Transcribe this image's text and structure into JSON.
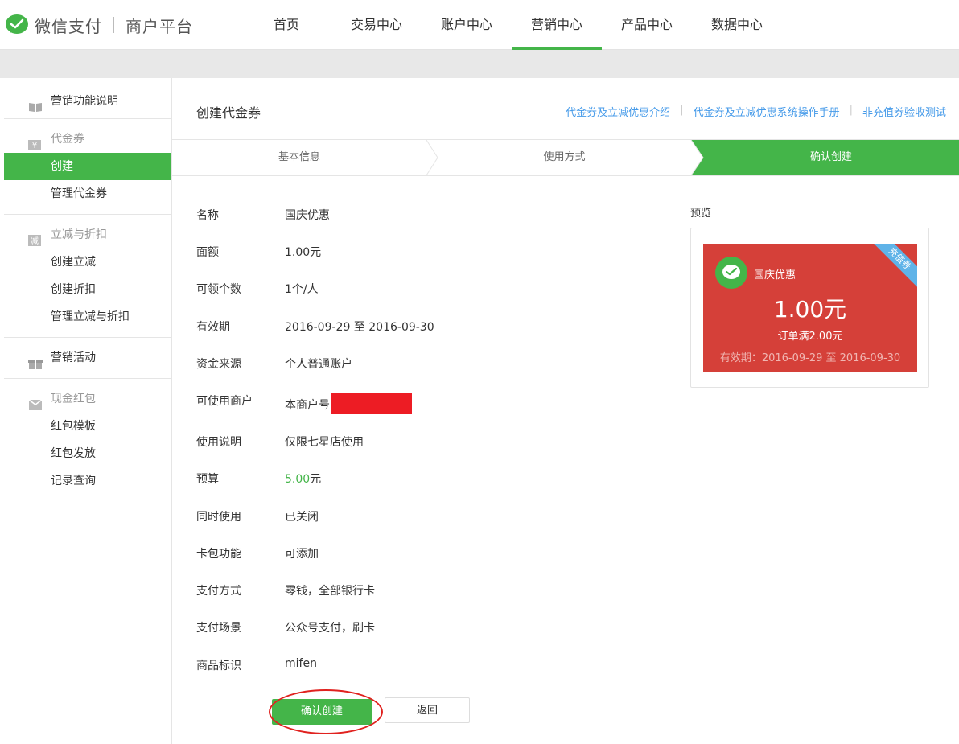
{
  "header": {
    "logo_text": "微信支付",
    "logo_sub": "商户平台",
    "nav": [
      "首页",
      "交易中心",
      "账户中心",
      "营销中心",
      "产品中心",
      "数据中心"
    ],
    "active_nav": "营销中心"
  },
  "sidebar": {
    "sections": [
      {
        "icon": "book-icon",
        "title": "营销功能说明",
        "items": []
      },
      {
        "icon": "yen-icon",
        "title": "代金券",
        "items": [
          "创建",
          "管理代金券"
        ],
        "active": "创建"
      },
      {
        "icon": "discount-icon",
        "title": "立减与折扣",
        "items": [
          "创建立减",
          "创建折扣",
          "管理立减与折扣"
        ]
      },
      {
        "icon": "gift-icon",
        "title": "营销活动",
        "items": []
      },
      {
        "icon": "red-packet-icon",
        "title": "现金红包",
        "items": [
          "红包模板",
          "红包发放",
          "记录查询"
        ]
      }
    ]
  },
  "main": {
    "title": "创建代金券",
    "links": [
      "代金券及立减优惠介绍",
      "代金券及立减优惠系统操作手册",
      "非充值券验收测试"
    ],
    "steps": [
      "基本信息",
      "使用方式",
      "确认创建"
    ],
    "fields": [
      {
        "label": "名称",
        "value": "国庆优惠"
      },
      {
        "label": "面额",
        "value": "1.00元"
      },
      {
        "label": "可领个数",
        "value": "1个/人"
      },
      {
        "label": "有效期",
        "value": "2016-09-29 至 2016-09-30"
      },
      {
        "label": "资金来源",
        "value": "个人普通账户"
      },
      {
        "label": "可使用商户",
        "value": "本商户号"
      },
      {
        "label": "使用说明",
        "value": "仅限七星店使用"
      },
      {
        "label": "预算",
        "value_green": "5.00",
        "value_unit": "元"
      },
      {
        "label": "同时使用",
        "value": "已关闭"
      },
      {
        "label": "卡包功能",
        "value": "可添加"
      },
      {
        "label": "支付方式",
        "value": "零钱，全部银行卡"
      },
      {
        "label": "支付场景",
        "value": "公众号支付，刷卡"
      },
      {
        "label": "商品标识",
        "value": "mifen"
      }
    ],
    "confirm_button": "确认创建",
    "back_button": "返回"
  },
  "preview": {
    "title": "预览",
    "coupon_name": "国庆优惠",
    "amount": "1.00元",
    "condition": "订单满2.00元",
    "validity": "有效期：2016-09-29 至 2016-09-30",
    "ribbon": "充值券",
    "colors": {
      "coupon_bg": "#d54039",
      "accent": "#44b549",
      "ribbon": "#5fb3e8"
    }
  }
}
